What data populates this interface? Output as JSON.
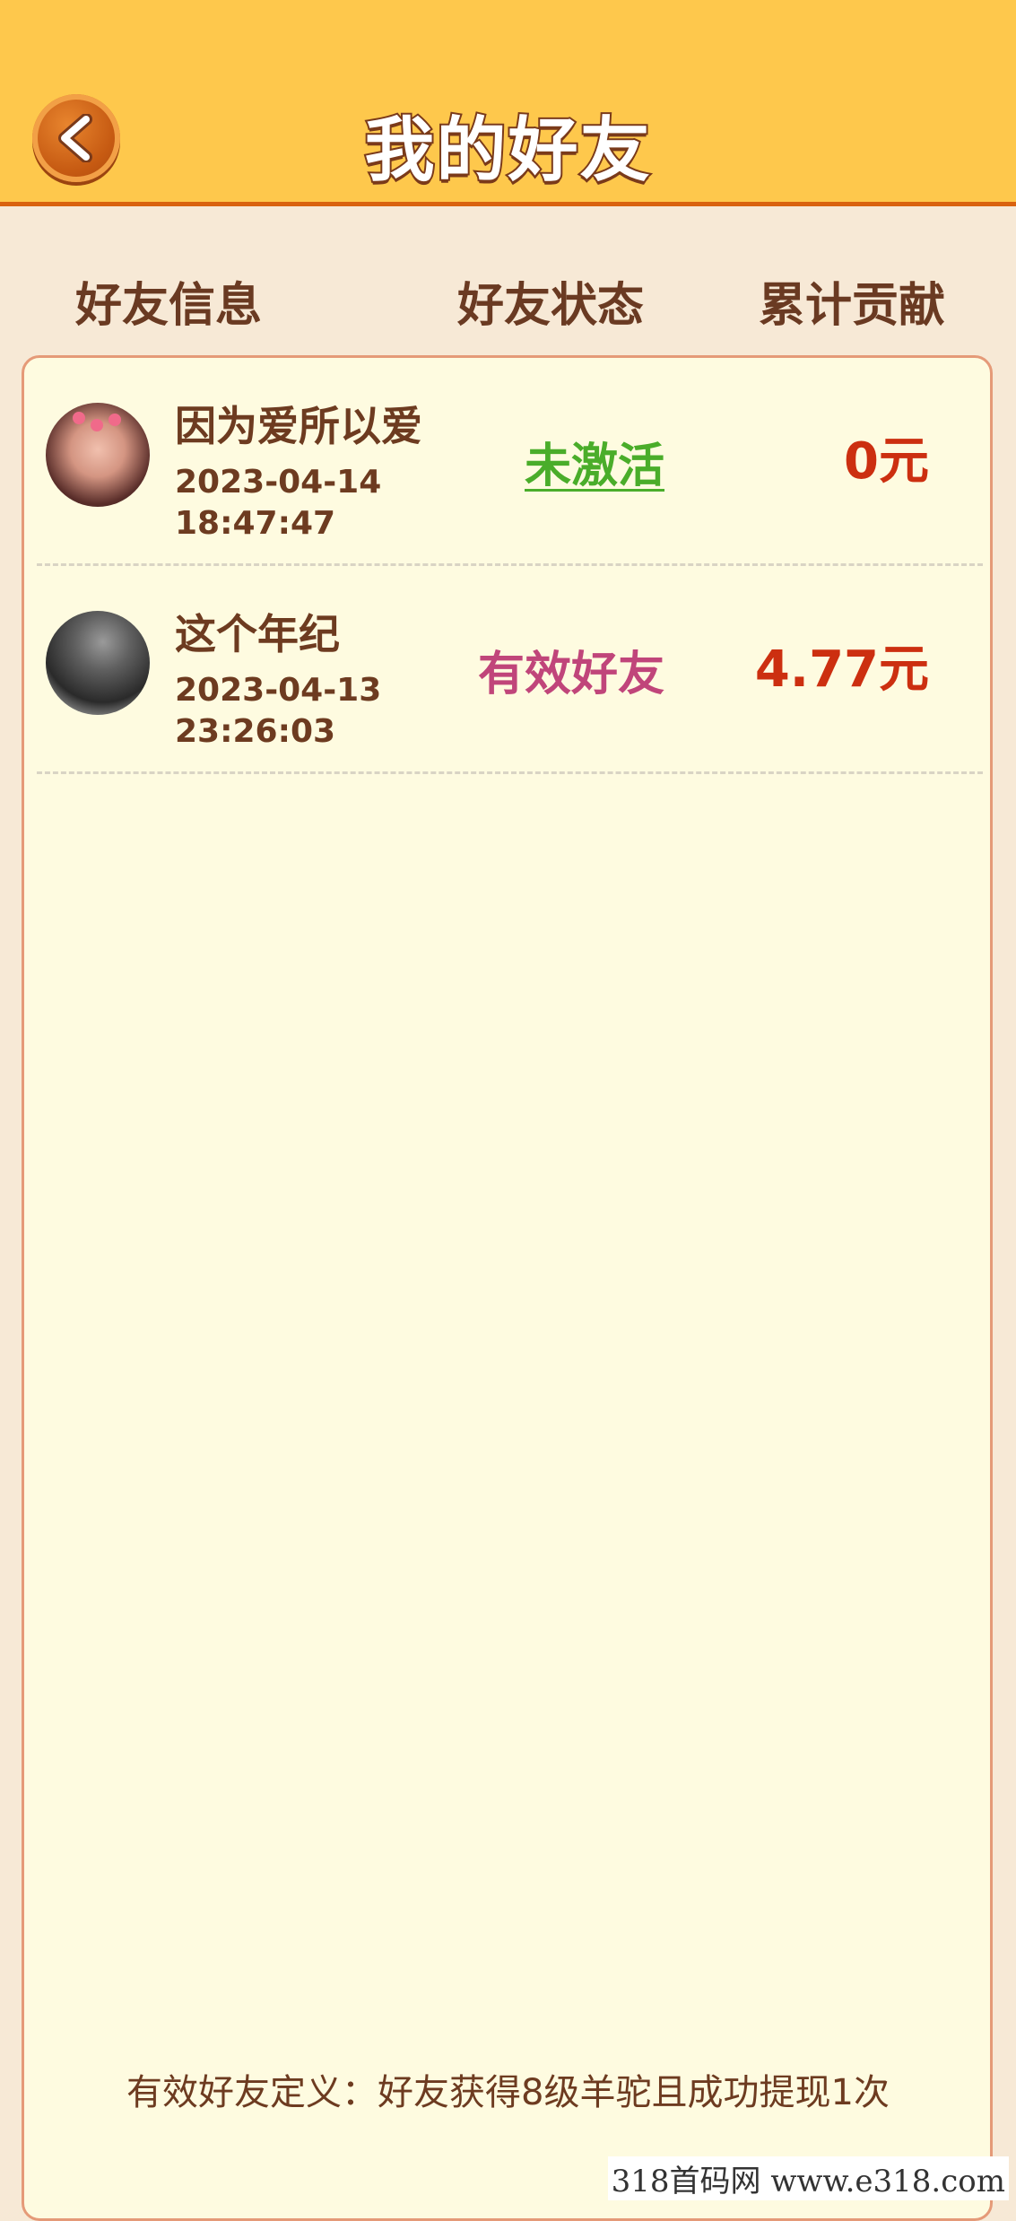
{
  "header": {
    "title": "我的好友"
  },
  "columns": {
    "info": "好友信息",
    "status": "好友状态",
    "contribution": "累计贡献"
  },
  "friends": [
    {
      "name": "因为爱所以爱",
      "date": "2023-04-14",
      "time": "18:47:47",
      "status": "未激活",
      "amount": "0元"
    },
    {
      "name": "这个年纪",
      "date": "2023-04-13",
      "time": "23:26:03",
      "status": "有效好友",
      "amount": "4.77元"
    }
  ],
  "footer": {
    "note": "有效好友定义：好友获得8级羊驼且成功提现1次"
  },
  "watermark": "318首码网  www.e318.com",
  "colors": {
    "header_bg": "#fec84c",
    "accent": "#d9620f",
    "inactive": "#4aad2a",
    "valid": "#c0457a",
    "amount": "#cc2f10"
  },
  "icons": {
    "back": "chevron-left-icon"
  }
}
